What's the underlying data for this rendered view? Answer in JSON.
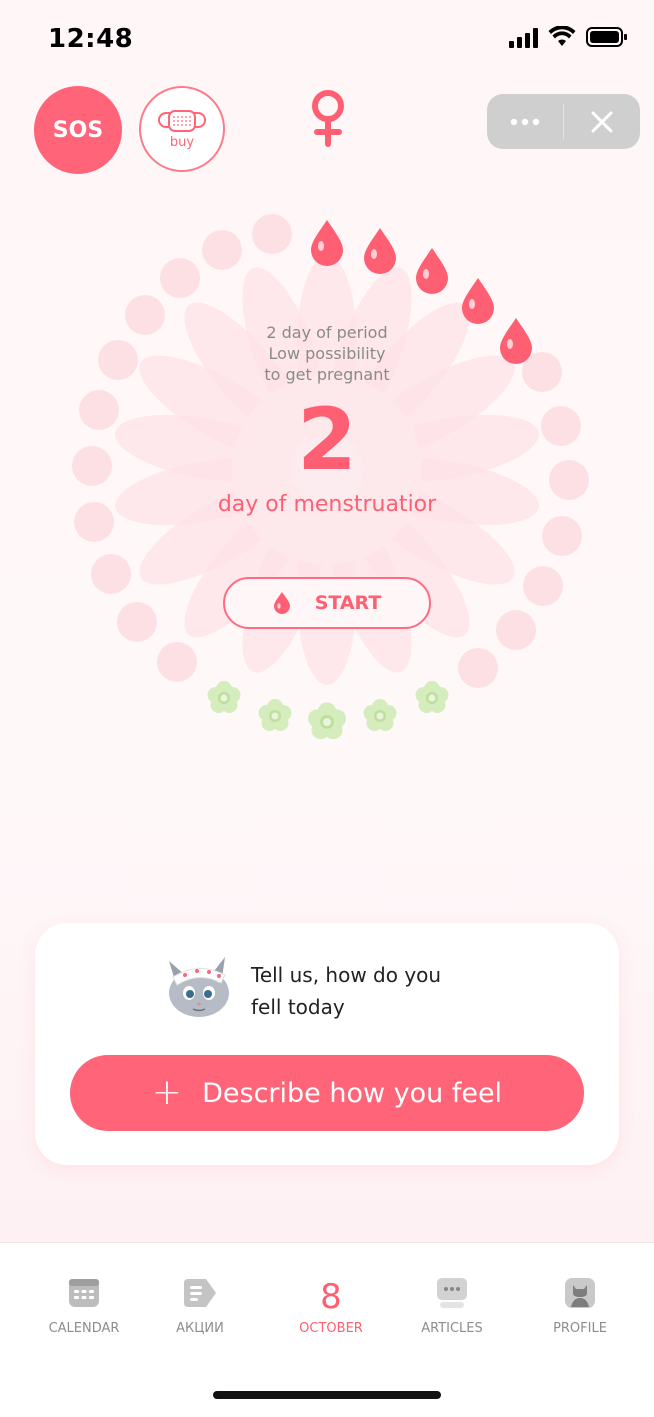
{
  "status_bar": {
    "time": "12:48"
  },
  "header": {
    "sos_label": "SOS",
    "buy_label": "buy"
  },
  "cycle": {
    "info_line1": "2 day of period",
    "info_line2": "Low possibility",
    "info_line3": "to get pregnant",
    "day_number": "2",
    "day_caption": "day of menstruatior",
    "start_label": "START"
  },
  "mood_card": {
    "prompt_line1": "Tell us, how do you",
    "prompt_line2": "fell today",
    "button_label": "Describe how you feel"
  },
  "nav": {
    "items": [
      {
        "label": "CALENDAR",
        "icon": "calendar-icon"
      },
      {
        "label": "АКЦИИ",
        "icon": "tag-icon"
      },
      {
        "label": "OCTOBER",
        "value": "8",
        "active": true
      },
      {
        "label": "ARTICLES",
        "icon": "chat-icon"
      },
      {
        "label": "PROFILE",
        "icon": "cat-profile-icon"
      }
    ]
  },
  "colors": {
    "accent": "#ff6478",
    "pale_pink": "#fde2e6",
    "leaf_green": "#cfe8b4"
  }
}
